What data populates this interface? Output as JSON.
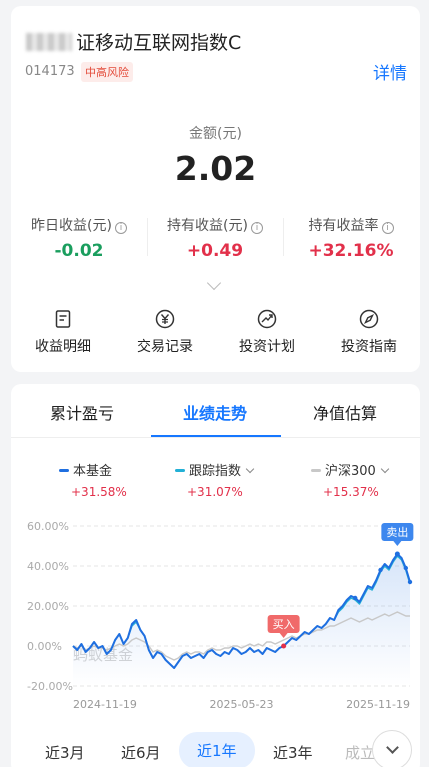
{
  "fund": {
    "name": "证移动互联网指数C",
    "code": "014173",
    "risk": "中高风险",
    "detail_label": "详情"
  },
  "amount": {
    "label": "金额(元)",
    "value": "2.02"
  },
  "stats": [
    {
      "label": "昨日收益(元)",
      "value": "-0.02",
      "tone": "green"
    },
    {
      "label": "持有收益(元)",
      "value": "+0.49",
      "tone": "red"
    },
    {
      "label": "持有收益率",
      "value": "+32.16%",
      "tone": "red"
    }
  ],
  "actions": [
    {
      "label": "收益明细",
      "icon": "document-icon"
    },
    {
      "label": "交易记录",
      "icon": "yen-icon"
    },
    {
      "label": "投资计划",
      "icon": "trend-icon"
    },
    {
      "label": "投资指南",
      "icon": "compass-icon"
    }
  ],
  "tabs": [
    {
      "label": "累计盈亏",
      "active": false
    },
    {
      "label": "业绩走势",
      "active": true
    },
    {
      "label": "净值估算",
      "active": false
    }
  ],
  "legend": [
    {
      "name": "本基金",
      "value": "+31.58%",
      "color": "#1f6fe0",
      "dropdown": false
    },
    {
      "name": "跟踪指数",
      "value": "+31.07%",
      "color": "#22b0d6",
      "dropdown": true
    },
    {
      "name": "沪深300",
      "value": "+15.37%",
      "color": "#c8c8c8",
      "dropdown": true
    }
  ],
  "periods": [
    {
      "label": "近3月",
      "active": false
    },
    {
      "label": "近6月",
      "active": false
    },
    {
      "label": "近1年",
      "active": true
    },
    {
      "label": "近3年",
      "active": false
    },
    {
      "label": "成立",
      "active": false
    }
  ],
  "chart_data": {
    "type": "line",
    "x_ticks": [
      "2024-11-19",
      "2025-05-23",
      "2025-11-19"
    ],
    "y_ticks": [
      "60.00%",
      "40.00%",
      "20.00%",
      "0.00%",
      "-20.00%"
    ],
    "ylim": [
      -20,
      60
    ],
    "watermark": "蚂蚁基金",
    "buy_label": "买入",
    "sell_label": "卖出",
    "buy_index": 50,
    "sell_index": 77,
    "series": [
      {
        "name": "本基金",
        "color": "#1f6fe0",
        "values": [
          0,
          -2,
          1,
          -3,
          -1,
          2,
          -1,
          0,
          -4,
          -2,
          3,
          6,
          1,
          4,
          11,
          13,
          8,
          5,
          -2,
          -6,
          -3,
          -4,
          -7,
          -9,
          -11,
          -8,
          -5,
          -4,
          -6,
          -5,
          -4,
          -6,
          -3,
          -2,
          -4,
          -5,
          -3,
          -4,
          -1,
          -2,
          -4,
          -3,
          -1,
          -3,
          -2,
          -4,
          -1,
          -2,
          -3,
          -1,
          0,
          2,
          4,
          3,
          5,
          7,
          6,
          8,
          10,
          9,
          11,
          14,
          13,
          18,
          20,
          23,
          25,
          24,
          22,
          26,
          30,
          29,
          33,
          38,
          41,
          39,
          43,
          46,
          44,
          39,
          32
        ]
      },
      {
        "name": "跟踪指数",
        "color": "#22b0d6",
        "values": [
          0,
          -2,
          1,
          -3,
          -1,
          2,
          -1,
          0,
          -4,
          -2,
          3,
          6,
          1,
          4,
          10,
          12,
          8,
          5,
          -2,
          -6,
          -3,
          -4,
          -7,
          -9,
          -11,
          -8,
          -5,
          -4,
          -6,
          -5,
          -4,
          -6,
          -3,
          -2,
          -4,
          -5,
          -3,
          -4,
          -1,
          -2,
          -4,
          -3,
          -1,
          -3,
          -2,
          -4,
          -1,
          -2,
          -3,
          -1,
          0,
          2,
          4,
          3,
          5,
          7,
          6,
          8,
          10,
          9,
          11,
          14,
          13,
          17,
          19,
          22,
          24,
          23,
          21,
          25,
          29,
          28,
          32,
          37,
          40,
          38,
          42,
          45,
          43,
          38,
          31
        ]
      },
      {
        "name": "沪深300",
        "color": "#c8c8c8",
        "values": [
          0,
          -1,
          0,
          -2,
          -1,
          0,
          -1,
          -1,
          -2,
          -1,
          0,
          1,
          0,
          1,
          3,
          4,
          3,
          2,
          0,
          -3,
          -2,
          -3,
          -5,
          -6,
          -7,
          -6,
          -4,
          -3,
          -4,
          -3,
          -3,
          -4,
          -2,
          -1,
          -2,
          -2,
          -1,
          -1,
          0,
          0,
          -1,
          0,
          1,
          0,
          1,
          0,
          2,
          2,
          1,
          2,
          3,
          4,
          5,
          4,
          5,
          6,
          6,
          7,
          8,
          8,
          9,
          10,
          10,
          11,
          12,
          13,
          14,
          13,
          12,
          13,
          14,
          13,
          14,
          15,
          16,
          15,
          16,
          17,
          16,
          15,
          15
        ]
      }
    ]
  }
}
